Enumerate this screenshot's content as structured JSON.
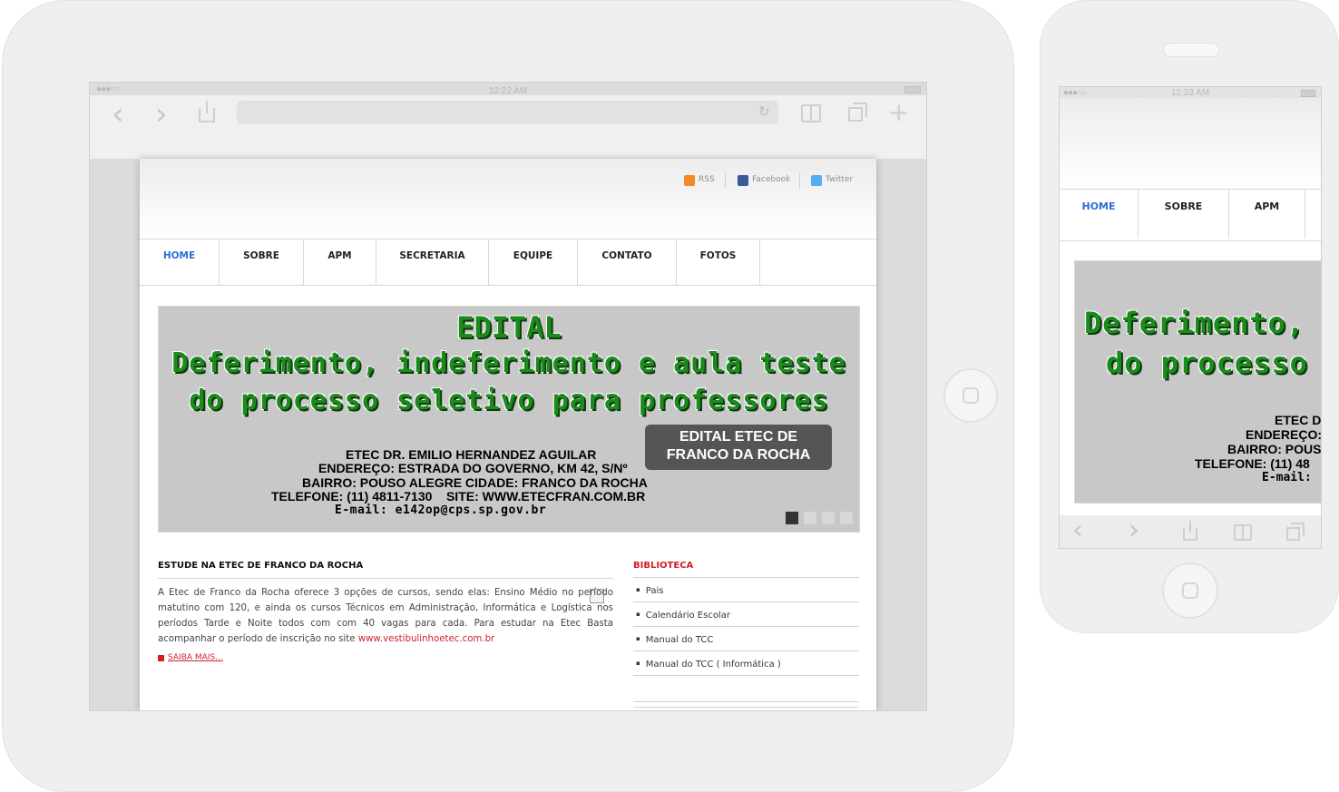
{
  "tablet": {
    "status": {
      "time": "12:22 AM"
    },
    "toolbar": {
      "back": "‹",
      "forward": "›",
      "plus": "+",
      "reload": "↻"
    },
    "header": {
      "social": [
        {
          "label": "RSS",
          "color": "#f08a24"
        },
        {
          "label": "Facebook",
          "color": "#3b5998"
        },
        {
          "label": "Twitter",
          "color": "#55acee"
        }
      ]
    },
    "nav": [
      "HOME",
      "SOBRE",
      "APM",
      "SECRETARIA",
      "EQUIPE",
      "CONTATO",
      "FOTOS"
    ],
    "banner": {
      "title": "EDITAL",
      "line1": "Deferimento, indeferimento e aula teste",
      "line2": "do processo seletivo para professores",
      "badge_line1": "EDITAL ETEC DE",
      "badge_line2": "FRANCO DA ROCHA",
      "info1": "ETEC DR. EMILIO HERNANDEZ AGUILAR",
      "info2": "ENDEREÇO: ESTRADA DO GOVERNO, KM 42, S/Nº",
      "info3": "BAIRRO: POUSO ALEGRE CIDADE: FRANCO DA ROCHA",
      "info4": "TELEFONE: (11) 4811-7130    SITE: WWW.ETECFRAN.COM.BR",
      "info5": "E-mail: e142op@cps.sp.gov.br"
    },
    "article": {
      "title": "ESTUDE NA ETEC DE FRANCO DA ROCHA",
      "text": "A Etec de Franco da Rocha oferece 3 opções de cursos, sendo elas: Ensino Médio no período matutino com 120, e ainda os cursos Técnicos em Administração, Informática e Logística nos períodos Tarde e Noite todos com com 40 vagas para cada. Para estudar na Etec Basta acompanhar o período de inscrição no site ",
      "link": "www.vestibulinhoetec.com.br",
      "more": "SAIBA MAIS..."
    },
    "sidebar": {
      "title": "BIBLIOTECA",
      "items": [
        "Pais",
        "Calendário Escolar",
        "Manual do TCC",
        "Manual do TCC ( Informática )"
      ]
    }
  },
  "phone": {
    "status": {
      "time": "12:23 AM"
    },
    "nav": [
      "HOME",
      "SOBRE",
      "APM"
    ],
    "banner": {
      "line1": "Deferimento,",
      "line2": "do processo",
      "info1": "ETEC D",
      "info2": "ENDEREÇO:",
      "info3": "BAIRRO: POUS",
      "info4": "TELEFONE: (11) 48",
      "info5": "E-mail:"
    },
    "toolbar": {
      "back": "‹",
      "forward": "›"
    }
  },
  "colors": {
    "accent": "#2a6fd6",
    "link": "#d0202a",
    "banner_green": "#1d8a1d"
  }
}
